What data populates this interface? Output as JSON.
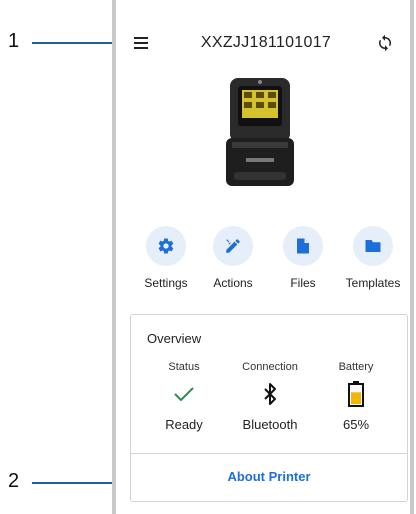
{
  "callouts": [
    {
      "number": "1"
    },
    {
      "number": "2"
    }
  ],
  "header": {
    "serial": "XXZJJ181101017",
    "menu_icon": "hamburger-menu-icon",
    "sync_icon": "sync-icon"
  },
  "device": {
    "image": "printer-image"
  },
  "actions": [
    {
      "label": "Settings",
      "icon": "gear-icon"
    },
    {
      "label": "Actions",
      "icon": "tools-icon"
    },
    {
      "label": "Files",
      "icon": "file-icon"
    },
    {
      "label": "Templates",
      "icon": "folder-icon"
    }
  ],
  "overview": {
    "title": "Overview",
    "columns": [
      {
        "heading": "Status",
        "value": "Ready",
        "icon": "checkmark-icon"
      },
      {
        "heading": "Connection",
        "value": "Bluetooth",
        "icon": "bluetooth-icon"
      },
      {
        "heading": "Battery",
        "value": "65%",
        "icon": "battery-icon",
        "level": 0.65
      }
    ],
    "link_label": "About Printer"
  },
  "colors": {
    "accent": "#1c6fd8",
    "icon_bg": "#e6eef9",
    "status_ok": "#2e8b57",
    "battery": "#f2b600",
    "callout_line": "#1f5f9e"
  }
}
